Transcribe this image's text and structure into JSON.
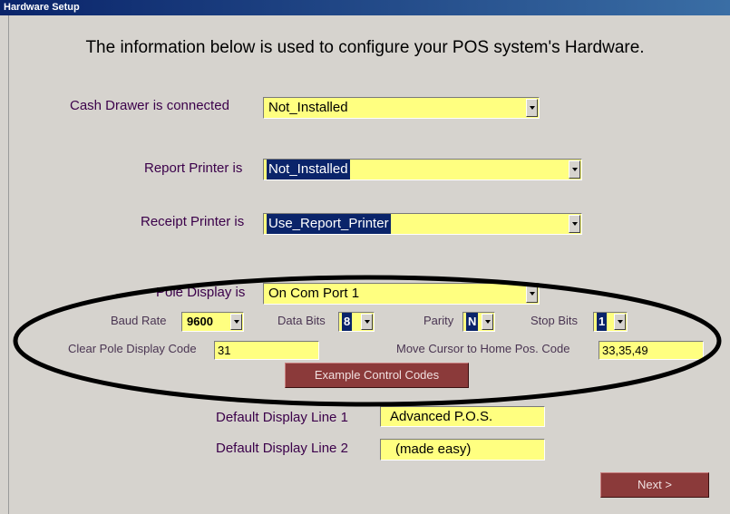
{
  "window": {
    "title": "Hardware Setup"
  },
  "headline": "The information below is used to configure your POS system's Hardware.",
  "cash_drawer": {
    "label": "Cash Drawer is connected",
    "value": "Not_Installed"
  },
  "report_printer": {
    "label": "Report Printer is",
    "value": "Not_Installed"
  },
  "receipt_printer": {
    "label": "Receipt Printer is",
    "value": "Use_Report_Printer"
  },
  "pole_display": {
    "label": "Pole Display is",
    "value": "On Com Port 1",
    "baud_label": "Baud Rate",
    "baud_value": "9600",
    "data_bits_label": "Data Bits",
    "data_bits_value": "8",
    "parity_label": "Parity",
    "parity_value": "N",
    "stop_bits_label": "Stop Bits",
    "stop_bits_value": "1",
    "clear_label": "Clear Pole Display Code",
    "clear_value": "31",
    "home_label": "Move Cursor to Home Pos. Code",
    "home_value": "33,35,49",
    "example_button": "Example Control Codes"
  },
  "default_line1": {
    "label": "Default Display Line 1",
    "value": "Advanced P.O.S."
  },
  "default_line2": {
    "label": "Default Display Line 2",
    "value": "(made easy)"
  },
  "next_button": "Next >",
  "colors": {
    "field": "#ffff80",
    "label": "#3b004a",
    "button": "#8b3a3a",
    "selection": "#0a246a"
  }
}
